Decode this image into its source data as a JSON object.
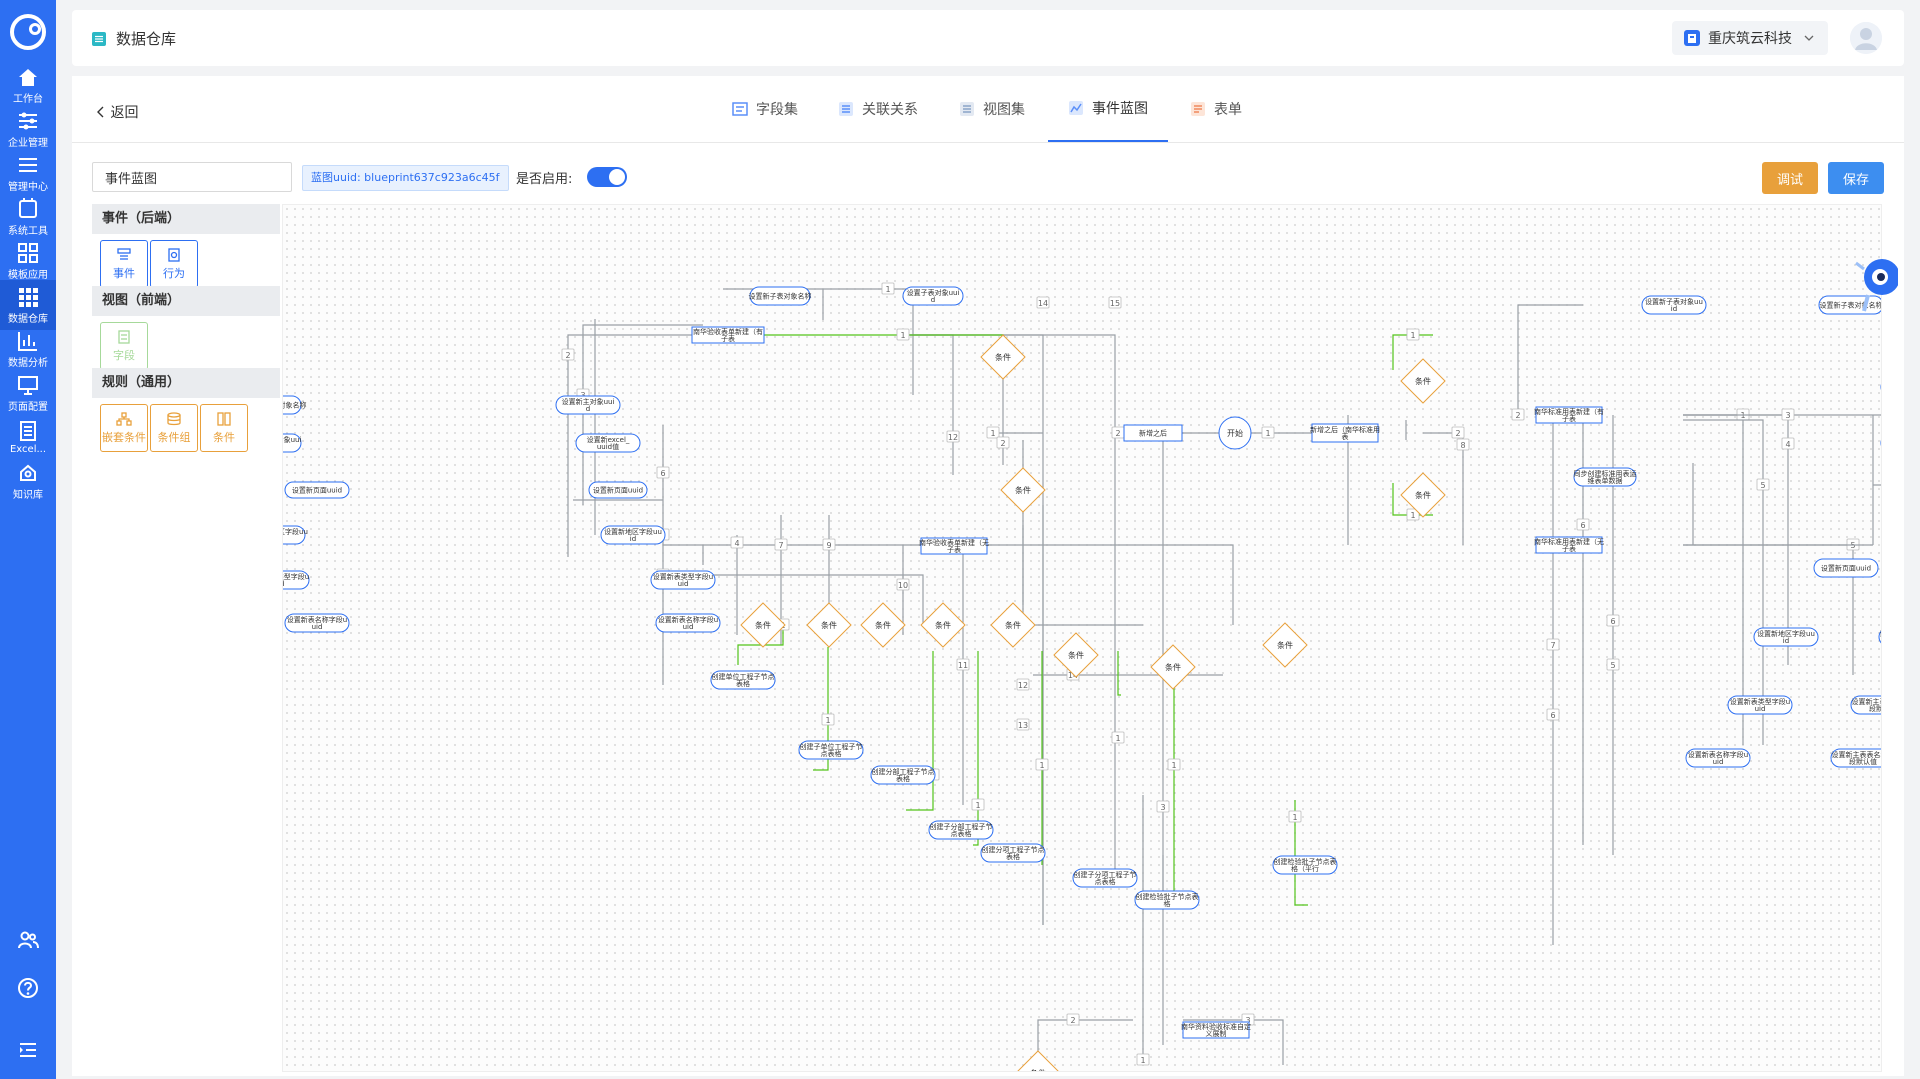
{
  "sidebar": {
    "items": [
      {
        "label": "工作台",
        "icon": "home-icon"
      },
      {
        "label": "企业管理",
        "icon": "sliders-icon"
      },
      {
        "label": "管理中心",
        "icon": "menu-icon"
      },
      {
        "label": "系统工具",
        "icon": "tool-icon"
      },
      {
        "label": "模板应用",
        "icon": "grid-icon"
      },
      {
        "label": "数据仓库",
        "icon": "database-grid-icon",
        "active": true
      },
      {
        "label": "数据分析",
        "icon": "bar-chart-icon"
      },
      {
        "label": "页面配置",
        "icon": "presentation-icon"
      },
      {
        "label": "Excel...",
        "icon": "excel-icon"
      },
      {
        "label": "知识库",
        "icon": "knowledge-icon"
      }
    ]
  },
  "header": {
    "title": "数据仓库",
    "company": "重庆筑云科技"
  },
  "toolbar": {
    "back_label": "返回"
  },
  "tabs": [
    {
      "label": "字段集",
      "color": "#5b8ff9"
    },
    {
      "label": "关联关系",
      "color": "#5b8ff9"
    },
    {
      "label": "视图集",
      "color": "#8aa4c8"
    },
    {
      "label": "事件蓝图",
      "color": "#5b8ff9",
      "active": true
    },
    {
      "label": "表单",
      "color": "#f08a5d"
    }
  ],
  "blueprint": {
    "name_value": "事件蓝图",
    "uuid_label": "蓝图uuid: blueprint637c923a6c45f",
    "enable_label": "是否启用:",
    "enabled": true,
    "debug_label": "调试",
    "save_label": "保存"
  },
  "palette": {
    "sections": [
      {
        "title": "事件（后端）",
        "items": [
          "事件",
          "行为"
        ]
      },
      {
        "title": "视图（前端）",
        "items": [
          "字段"
        ]
      },
      {
        "title": "规则（通用）",
        "items": [
          "嵌套条件",
          "条件组",
          "条件"
        ]
      }
    ]
  },
  "canvas": {
    "start": "开始",
    "rect_nodes": [
      "新增之后",
      "新增之后（南华标准用表",
      "南华标准用表新建（无子表",
      "南华标准用表新建（有子表",
      "南华验收表单新建（无子表",
      "南华验收表单新建（有子表",
      "南华资料验收标准自定义展制",
      "同步创建标准用表运维表单数据"
    ],
    "round_nodes": [
      "设置新子表对象名称",
      "设置子表对象uuid",
      "设置新主对象uuid",
      "设置新excel_uuid值",
      "设置新页面uuid",
      "设置新地区字段uuid",
      "设置新表类型字段uuid",
      "设置新表名称字段uuid",
      "创建单位工程子节点表格",
      "创建子单位工程子节点表格",
      "创建分部工程子节点表格",
      "创建子分部工程子节点表格",
      "创建分项工程子节点表格",
      "创建子分项工程子节点表格",
      "创建检验批子节点表格",
      "创建检验批子节点表格（平行",
      "设置新子表对象uuid",
      "设置新对象uuid",
      "设置新excel_uuid",
      "设置新页面uuid",
      "设置新页面名称",
      "设置新地区字段uuid",
      "设置新主表地区字段默认值",
      "设置新表类型字段uuid",
      "设置新主表表类型字段默认值",
      "设置新表名称字段uuid",
      "设置新主表表名称字段默认值"
    ],
    "condition_label": "条件",
    "edge_labels": [
      "1",
      "2",
      "3",
      "4",
      "5",
      "6",
      "7",
      "8",
      "9",
      "10",
      "11",
      "12",
      "13",
      "14",
      "15"
    ]
  },
  "colors": {
    "primary": "#2d6ff2",
    "sidebar": "#2d6ff2",
    "debug": "#e8a03b",
    "save": "#3d8ef0",
    "edge_gray": "#9aa0a6",
    "edge_green": "#52c41a",
    "condition": "#e8a03b"
  }
}
